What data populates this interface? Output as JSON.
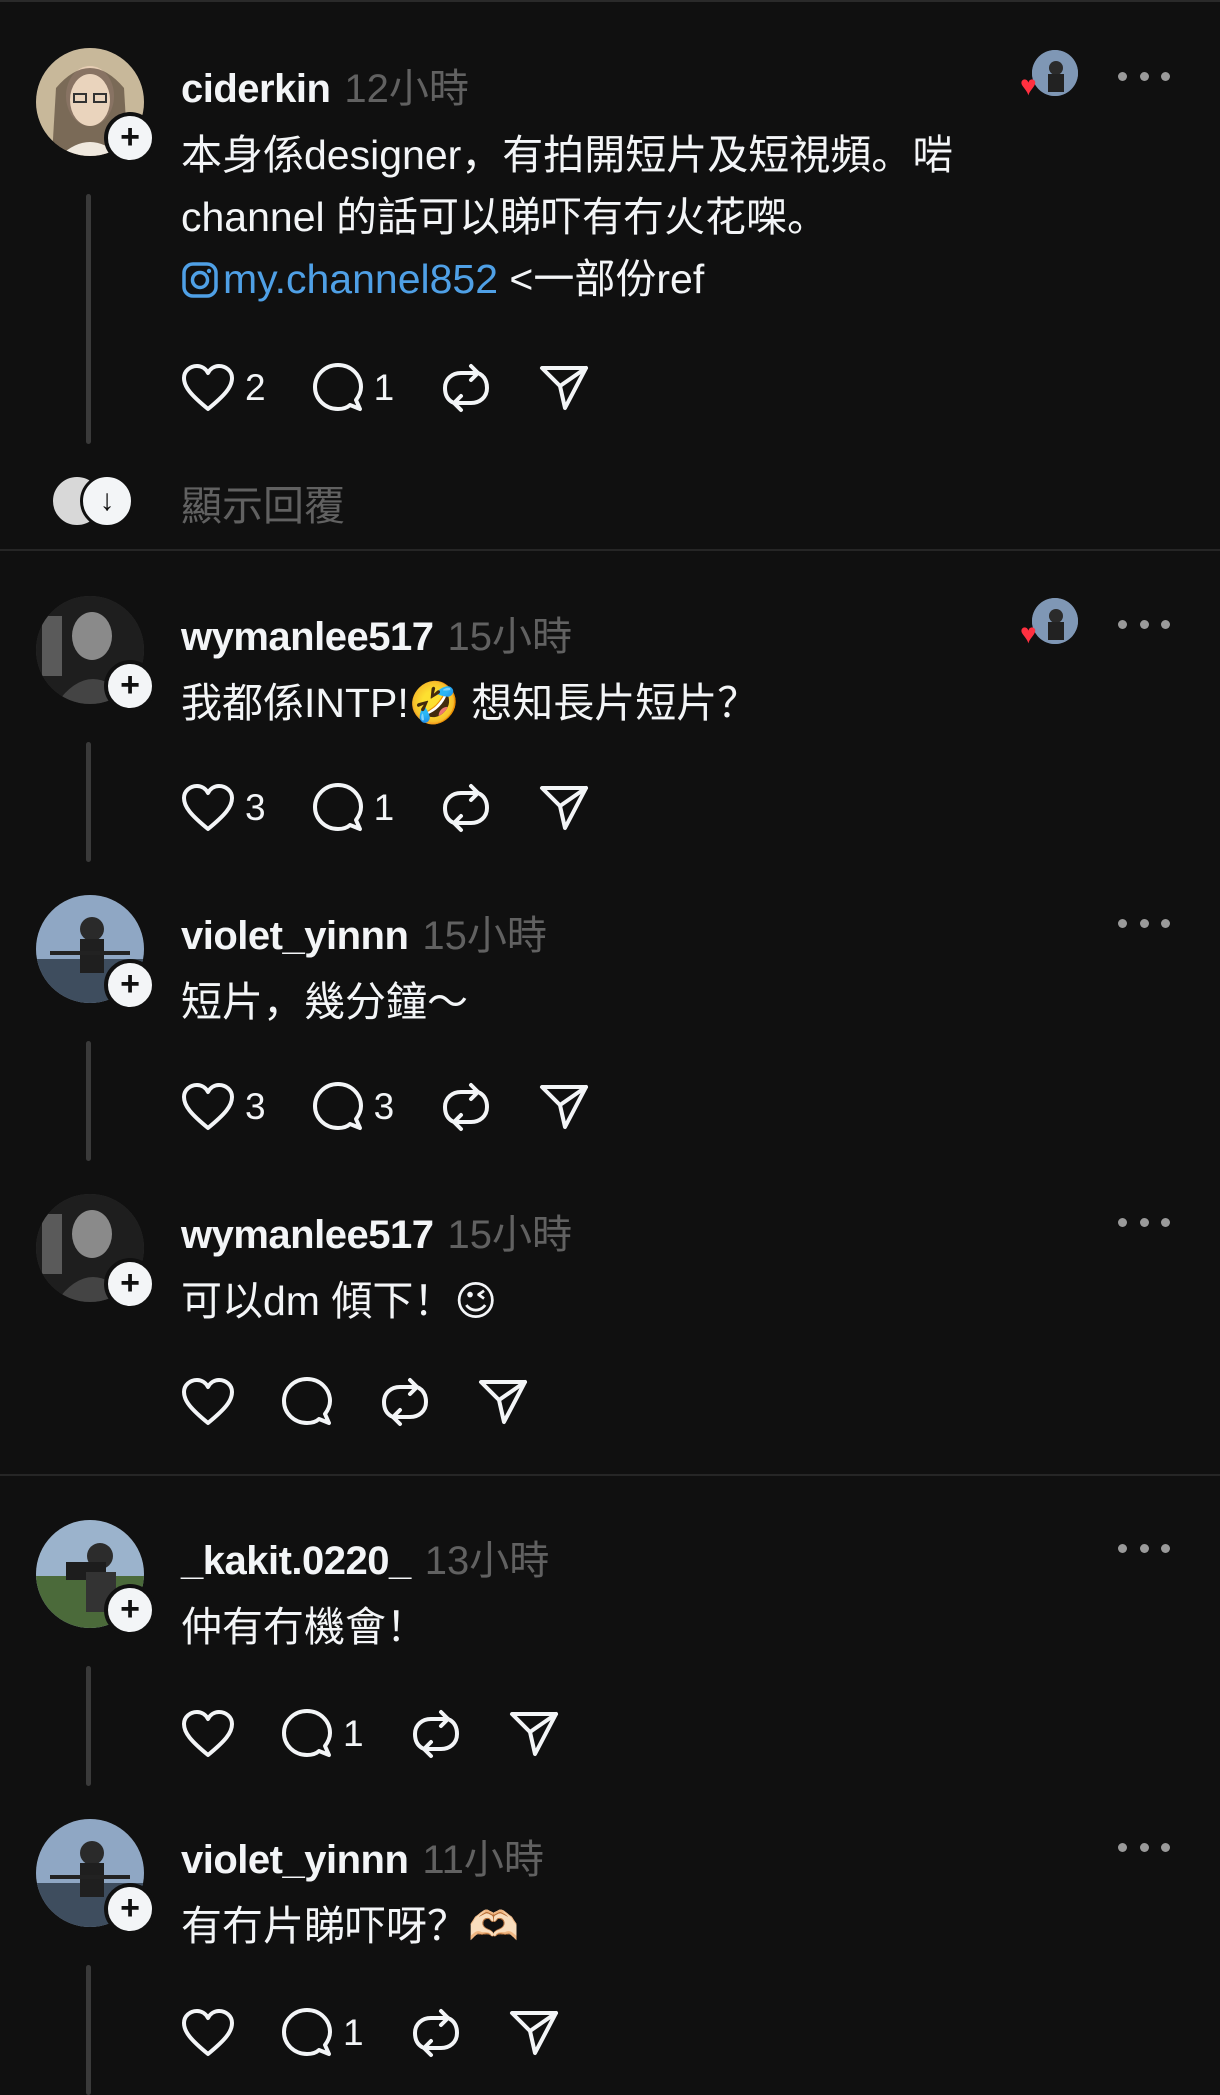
{
  "posts": [
    {
      "username": "ciderkin",
      "time": "12小時",
      "text_lines": [
        "本身係designer，有拍開短片及短視頻。啱",
        "channel 的話可以睇吓有冇火花㗎。"
      ],
      "link_text": "my.channel852",
      "link_suffix": " <一部份ref",
      "likes": "2",
      "replies": "1",
      "liked_by_author": true
    },
    {
      "username": "wymanlee517",
      "time": "15小時",
      "text": "我都係INTP!🤣 想知長片短片？",
      "likes": "3",
      "replies": "1",
      "liked_by_author": true
    },
    {
      "username": "violet_yinnn",
      "time": "15小時",
      "text": "短片，幾分鐘～",
      "likes": "3",
      "replies": "3"
    },
    {
      "username": "wymanlee517",
      "time": "15小時",
      "text": "可以dm 傾下！😉",
      "likes": "",
      "replies": ""
    },
    {
      "username": "_kakit.0220_",
      "time": "13小時",
      "text": "仲有冇機會！",
      "likes": "",
      "replies": "1"
    },
    {
      "username": "violet_yinnn",
      "time": "11小時",
      "text": "有冇片睇吓呀？🫶🏻",
      "likes": "",
      "replies": "1"
    }
  ],
  "show_replies_label": "顯示回覆",
  "icons": {
    "like": "heart-icon",
    "reply": "comment-icon",
    "repost": "repost-icon",
    "share": "send-icon",
    "more": "more-icon",
    "instagram": "instagram-icon",
    "follow": "plus-icon"
  },
  "colors": {
    "background": "#101010",
    "text": "#f3f5f7",
    "secondary_text": "#616161",
    "link": "#4fa0e6",
    "heart": "#ff3040"
  }
}
